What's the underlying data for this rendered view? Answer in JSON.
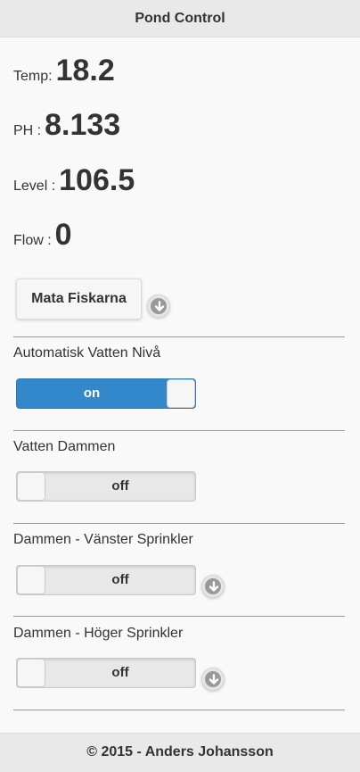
{
  "header": {
    "title": "Pond Control"
  },
  "readings": {
    "temp": {
      "label": "Temp:",
      "value": "18.2"
    },
    "ph": {
      "label": "PH :",
      "value": "8.133"
    },
    "level": {
      "label": "Level :",
      "value": "106.5"
    },
    "flow": {
      "label": "Flow :",
      "value": "0"
    }
  },
  "feed_button": {
    "label": "Mata Fiskarna",
    "icon": "arrow-down-icon"
  },
  "switches": [
    {
      "label": "Automatisk Vatten Nivå",
      "state": "on",
      "has_expand": false
    },
    {
      "label": "Vatten Dammen",
      "state": "off",
      "has_expand": false
    },
    {
      "label": "Dammen - Vänster Sprinkler",
      "state": "off",
      "has_expand": true
    },
    {
      "label": "Dammen - Höger Sprinkler",
      "state": "off",
      "has_expand": true
    }
  ],
  "footer": {
    "text": "© 2015 - Anders Johansson"
  },
  "colors": {
    "accent": "#3388cc",
    "bar_bg": "#e9e9e9",
    "page_bg": "#f9f9f9"
  }
}
